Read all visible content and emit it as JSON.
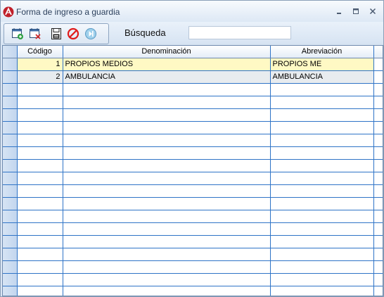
{
  "window": {
    "title": "Forma de ingreso a guardia"
  },
  "toolbar": {
    "buttons": [
      {
        "icon": "calendar-add-icon"
      },
      {
        "icon": "calendar-delete-icon"
      },
      {
        "icon": "save-icon"
      },
      {
        "icon": "cancel-icon"
      },
      {
        "icon": "next-icon"
      }
    ],
    "search_label": "Búsqueda",
    "search_value": ""
  },
  "grid": {
    "columns": [
      "Código",
      "Denominación",
      "Abreviación"
    ],
    "rows": [
      {
        "codigo": "1",
        "denominacion": "PROPIOS MEDIOS",
        "abreviacion": "PROPIOS ME"
      },
      {
        "codigo": "2",
        "denominacion": "AMBULANCIA",
        "abreviacion": "AMBULANCIA"
      }
    ]
  },
  "colors": {
    "selected_row": "#fff9c4",
    "grid_line": "#2f74c7",
    "title_text": "#2b3f5c"
  }
}
